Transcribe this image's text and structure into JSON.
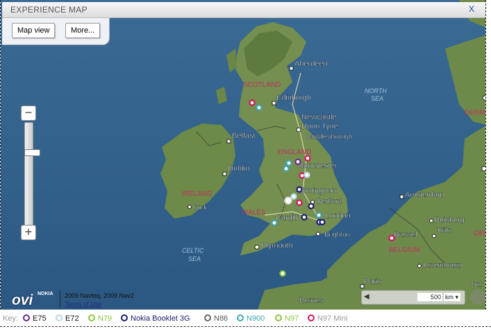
{
  "header": {
    "title": "EXPERIENCE MAP",
    "close_label": "X"
  },
  "buttons": {
    "map_view": "Map view",
    "more": "More..."
  },
  "zoom": {
    "minus": "−",
    "plus": "+"
  },
  "map": {
    "countries": [
      "SCOTLAND",
      "ENGLAND",
      "WALES",
      "IRELAND",
      "BELGIUM",
      "DENMA",
      "GER"
    ],
    "seas": [
      "NORTH",
      "SEA",
      "CELTIC",
      "SEA"
    ],
    "cities": [
      "Aberdeen",
      "Edinburgh",
      "Newcastle",
      "Upon Tyne",
      "Middlesbrough",
      "Belfast",
      "Dublin",
      "Manchester",
      "Birmingham",
      "Bedford",
      "Cork",
      "Cardiff",
      "London",
      "Brighton",
      "Plymouth",
      "Amsterdam",
      "Duisburg",
      "Köln",
      "Brussel",
      "Luxembourg",
      "Paris",
      "Rennes",
      "Stu"
    ]
  },
  "footer": {
    "brand": "ovi",
    "brand_small": "NOKIA",
    "copyright": "2009 Navteq, 2009 Nav2",
    "terms": "Terms of Use"
  },
  "scale": {
    "value": "500",
    "unit": "km"
  },
  "legend": {
    "key_label": "Key:",
    "items": [
      {
        "label": "E75",
        "color": "#6b2a8a"
      },
      {
        "label": "E72",
        "color": "#b9d8ea"
      },
      {
        "label": "N79",
        "color": "#8dc63f"
      },
      {
        "label": "Nokia Booklet 3G",
        "color": "#1a1a6e"
      },
      {
        "label": "N86",
        "color": "#666666"
      },
      {
        "label": "N900",
        "color": "#3fa5b5"
      },
      {
        "label": "N97",
        "color": "#8dc63f"
      },
      {
        "label": "N97 Mini",
        "color": "#d4145a"
      }
    ]
  },
  "colors": {
    "sea": "#2e5d86",
    "land": "#6f8a4c",
    "link": "#2240a8"
  }
}
